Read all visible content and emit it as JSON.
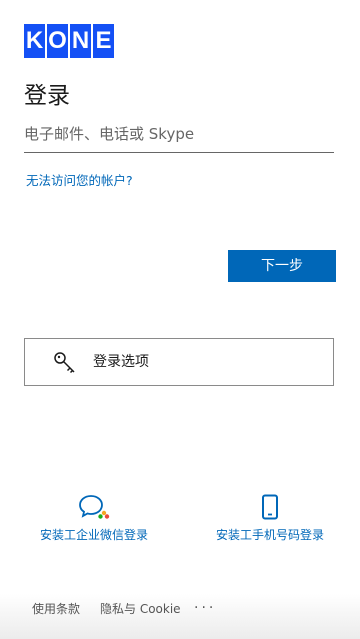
{
  "brand": {
    "letters": [
      "K",
      "O",
      "N",
      "E"
    ],
    "color": "#1450f5"
  },
  "page": {
    "title": "登录"
  },
  "signin": {
    "email_placeholder": "电子邮件、电话或 Skype",
    "email_value": "",
    "forgot_link": "无法访问您的帐户?",
    "next_label": "下一步"
  },
  "options": {
    "label": "登录选项",
    "icon": "key-icon"
  },
  "alternatives": [
    {
      "label": "安装工企业微信登录",
      "icon": "wechat-work-icon"
    },
    {
      "label": "安装工手机号码登录",
      "icon": "mobile-phone-icon"
    }
  ],
  "footer": {
    "terms": "使用条款",
    "privacy": "隐私与 Cookie",
    "more": "..."
  },
  "colors": {
    "accent": "#0067b8",
    "brand": "#1450f5"
  }
}
